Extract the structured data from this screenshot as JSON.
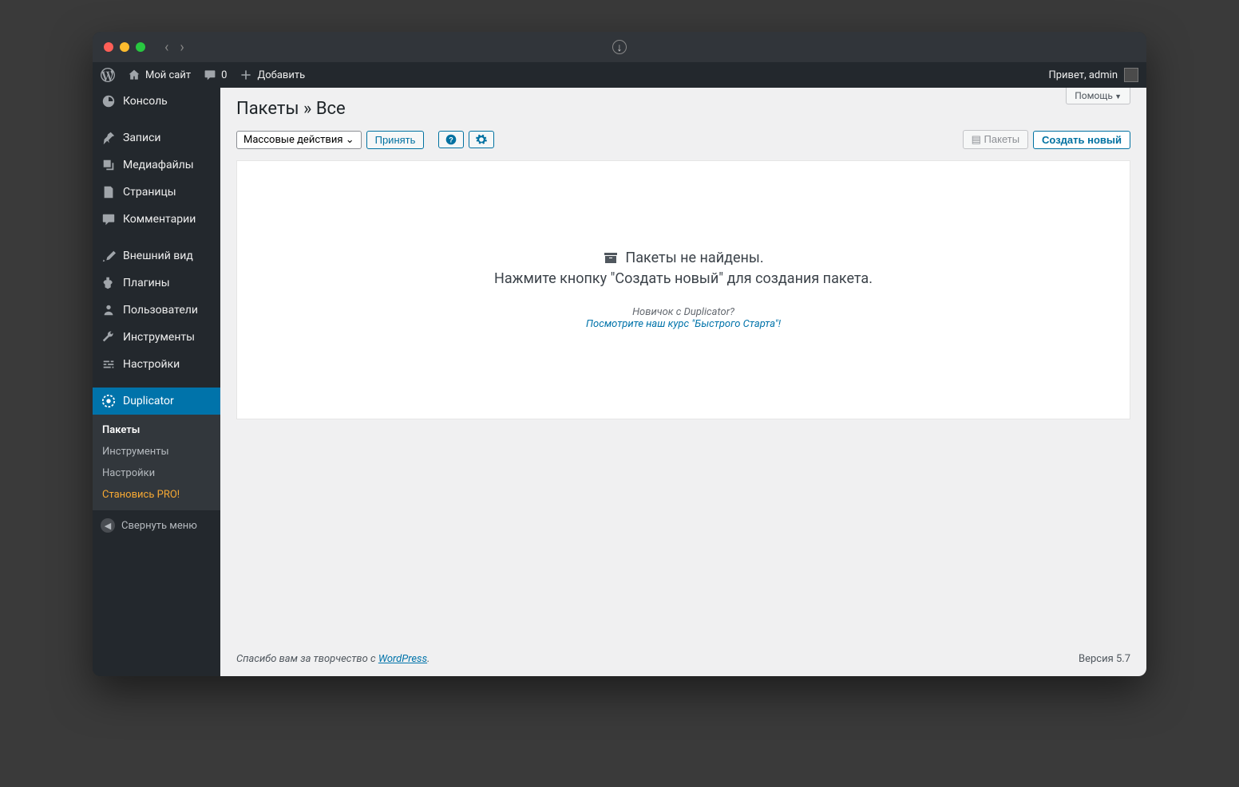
{
  "adminbar": {
    "site_name": "Мой сайт",
    "comments_count": "0",
    "add_new": "Добавить",
    "greeting": "Привет, admin"
  },
  "sidebar": {
    "items": [
      {
        "label": "Консоль"
      },
      {
        "label": "Записи"
      },
      {
        "label": "Медиафайлы"
      },
      {
        "label": "Страницы"
      },
      {
        "label": "Комментарии"
      },
      {
        "label": "Внешний вид"
      },
      {
        "label": "Плагины"
      },
      {
        "label": "Пользователи"
      },
      {
        "label": "Инструменты"
      },
      {
        "label": "Настройки"
      },
      {
        "label": "Duplicator"
      }
    ],
    "submenu": [
      {
        "label": "Пакеты"
      },
      {
        "label": "Инструменты"
      },
      {
        "label": "Настройки"
      },
      {
        "label": "Становись PRO!"
      }
    ],
    "collapse": "Свернуть меню"
  },
  "page": {
    "title": "Пакеты » Все",
    "help": "Помощь",
    "bulk_actions": "Массовые действия",
    "apply": "Принять",
    "packages_btn": "Пакеты",
    "create_new": "Создать новый",
    "no_packages": "Пакеты не найдены.",
    "instruction": "Нажмите кнопку \"Создать новый\" для создания пакета.",
    "newbie": "Новичок с Duplicator?",
    "quickstart": "Посмотрите наш курс \"Быстрого Старта\"!"
  },
  "footer": {
    "thanks_prefix": "Спасибо вам за творчество с ",
    "wp_link": "WordPress",
    "thanks_suffix": ".",
    "version": "Версия 5.7"
  }
}
